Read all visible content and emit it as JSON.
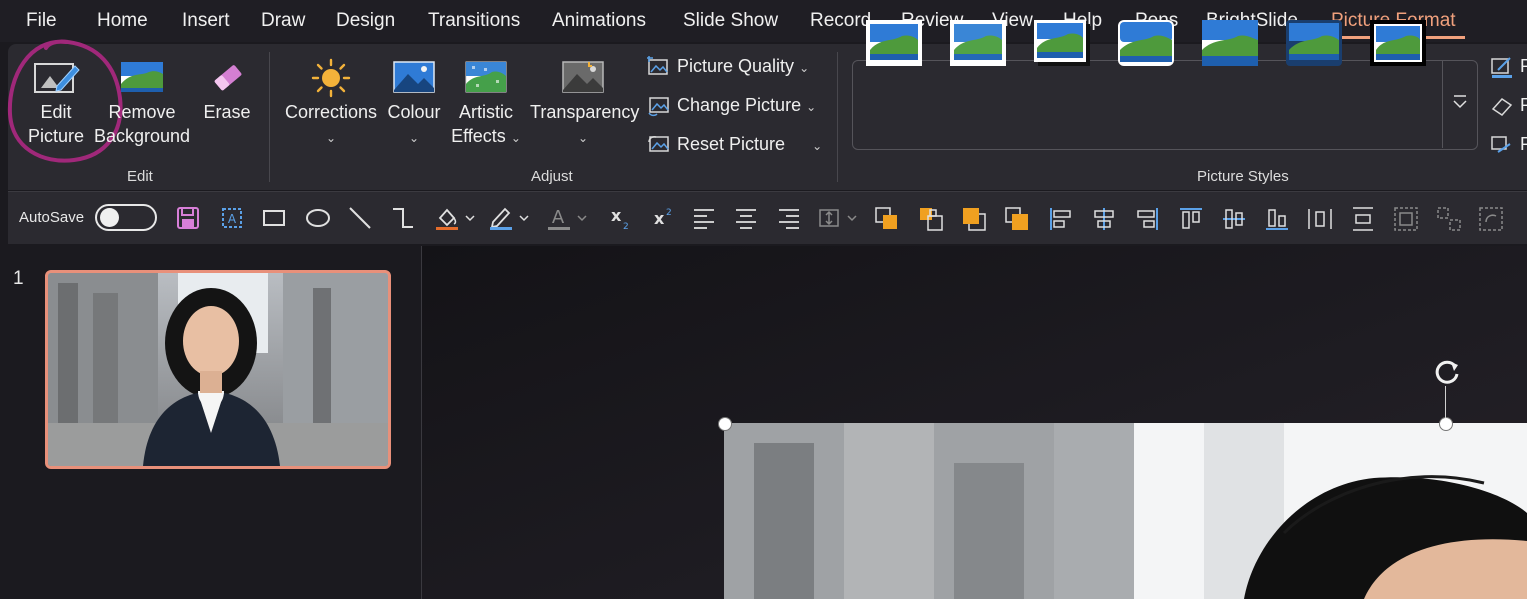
{
  "menu": {
    "tabs": [
      "File",
      "Home",
      "Insert",
      "Draw",
      "Design",
      "Transitions",
      "Animations",
      "Slide Show",
      "Record",
      "Review",
      "View",
      "Help",
      "Pens",
      "BrightSlide",
      "Picture Format"
    ],
    "active_tab": "Picture Format"
  },
  "ribbon": {
    "edit_group": {
      "label": "Edit",
      "edit_picture": [
        "Edit",
        "Picture"
      ],
      "remove_background": [
        "Remove",
        "Background"
      ],
      "erase": "Erase"
    },
    "adjust_group": {
      "label": "Adjust",
      "corrections": "Corrections",
      "colour": "Colour",
      "artistic_effects": [
        "Artistic",
        "Effects"
      ],
      "transparency": "Transparency",
      "picture_quality": "Picture Quality",
      "change_picture": "Change Picture",
      "reset_picture": "Reset Picture"
    },
    "styles_group": {
      "label": "Picture Styles"
    },
    "right_cutoff": [
      "P",
      "P",
      "P"
    ]
  },
  "qat": {
    "autosave_label": "AutoSave",
    "autosave_on": false
  },
  "slides": {
    "number": "1"
  },
  "colors": {
    "accent": "#f1a17d",
    "annotation_circle": "#a0287a",
    "thumb_border": "#e8907a"
  }
}
